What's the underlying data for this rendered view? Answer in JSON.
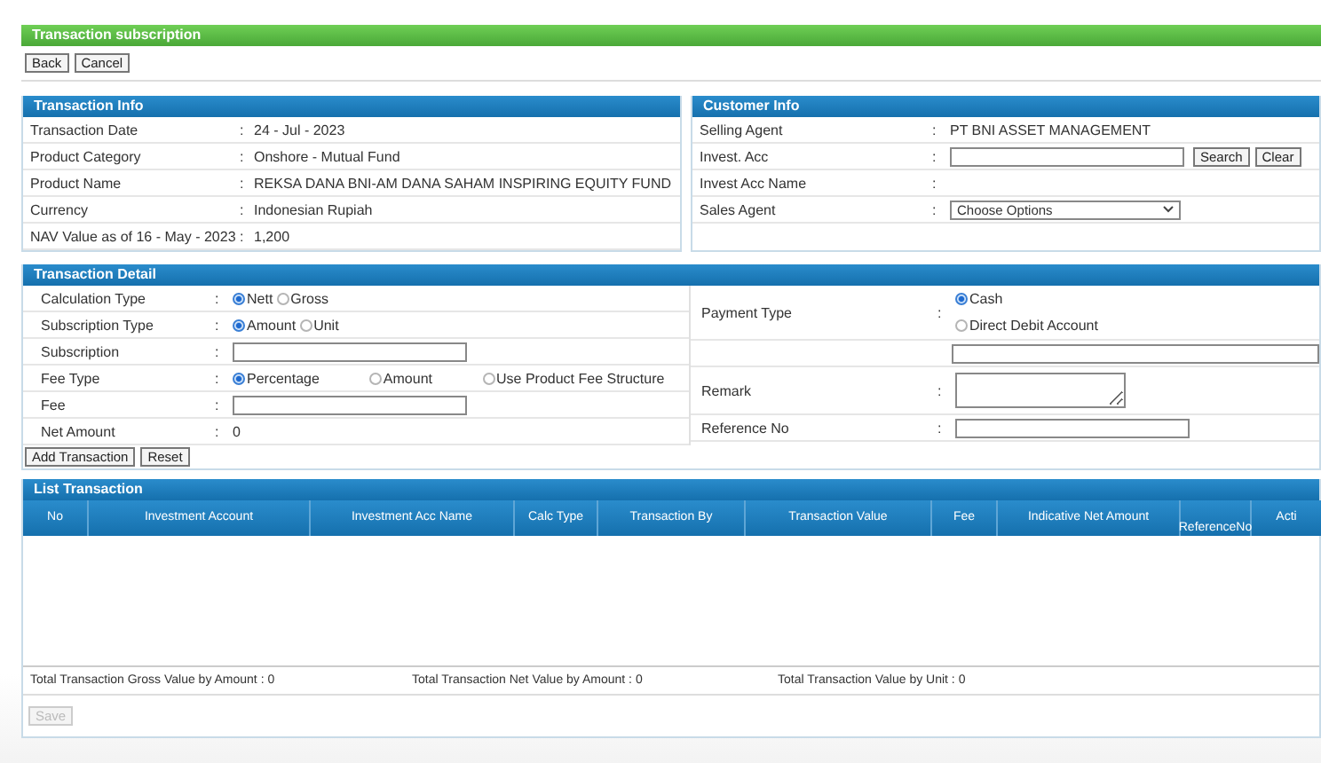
{
  "page_title": "Transaction subscription",
  "top_buttons": [
    "Back",
    "Cancel"
  ],
  "transaction_info": {
    "title": "Transaction Info",
    "rows": [
      {
        "label": "Transaction Date",
        "sep": ":",
        "kind": "text",
        "value": "24 - Jul - 2023"
      },
      {
        "label": "Product Category",
        "sep": ":",
        "kind": "text",
        "value": "Onshore - Mutual Fund"
      },
      {
        "label": "Product Name",
        "sep": ":",
        "kind": "text",
        "value": "REKSA DANA BNI-AM DANA SAHAM INSPIRING EQUITY FUND"
      },
      {
        "label": "Currency",
        "sep": ":",
        "kind": "text",
        "value": "Indonesian Rupiah"
      },
      {
        "label": "NAV Value as of 16 - May - 2023",
        "sep": ":",
        "kind": "text",
        "value": "1,200"
      }
    ]
  },
  "customer_info": {
    "title": "Customer Info",
    "rows": [
      {
        "label": "Selling Agent",
        "sep": ":",
        "kind": "text",
        "value": "PT BNI ASSET MANAGEMENT"
      },
      {
        "label": "Invest. Acc",
        "sep": ":",
        "kind": "input",
        "buttons": [
          "Search",
          "Clear"
        ]
      },
      {
        "label": "Invest Acc Name",
        "sep": ":",
        "kind": "text"
      },
      {
        "label": "Sales Agent",
        "sep": ":",
        "kind": "select",
        "value": "Choose Options"
      }
    ]
  },
  "transaction_detail": {
    "title": "Transaction Detail",
    "left": [
      {
        "label": "Calculation Type",
        "sep": ":",
        "kind": "radios",
        "options": [
          {
            "label": "Nett",
            "selected": true
          },
          {
            "label": "Gross",
            "selected": false
          }
        ]
      },
      {
        "label": "Subscription Type",
        "sep": ":",
        "kind": "radios",
        "options": [
          {
            "label": "Amount",
            "selected": true
          },
          {
            "label": "Unit",
            "selected": false
          }
        ]
      },
      {
        "label": "Subscription",
        "sep": ":",
        "kind": "input"
      },
      {
        "label": "Fee Type",
        "sep": ":",
        "kind": "radios",
        "spread": true,
        "options": [
          {
            "label": "Percentage",
            "selected": true
          },
          {
            "label": "Amount",
            "selected": false
          },
          {
            "label": "Use Product Fee Structure",
            "selected": false
          }
        ]
      },
      {
        "label": "Fee",
        "sep": ":",
        "kind": "input"
      },
      {
        "label": "Net Amount",
        "sep": ":",
        "kind": "text",
        "value": "0"
      }
    ],
    "right": [
      {
        "label": "Payment Type",
        "sep": ":",
        "kind": "radios",
        "stacked": true,
        "options": [
          {
            "label": "Cash",
            "selected": true
          },
          {
            "label": "Direct Debit Account",
            "selected": false
          }
        ]
      },
      {
        "kind": "wide-input"
      },
      {
        "label": "Remark",
        "sep": ":",
        "kind": "textarea"
      },
      {
        "label": "Reference No",
        "sep": ":",
        "kind": "input"
      }
    ],
    "buttons": [
      "Add Transaction",
      "Reset"
    ]
  },
  "list_transaction": {
    "title": "List Transaction",
    "columns": [
      "No",
      "Investment Account",
      "Investment Acc Name",
      "Calc Type",
      "Transaction By",
      "Transaction Value",
      "Fee",
      "Indicative Net Amount",
      "ReferenceNo",
      "Acti"
    ],
    "totals": [
      {
        "label": "Total Transaction Gross Value by Amount :",
        "value": "0"
      },
      {
        "label": "Total Transaction Net Value by Amount :",
        "value": "0"
      },
      {
        "label": "Total Transaction Value by Unit :",
        "value": "0"
      }
    ],
    "save_button": {
      "label": "Save",
      "disabled": true
    }
  }
}
